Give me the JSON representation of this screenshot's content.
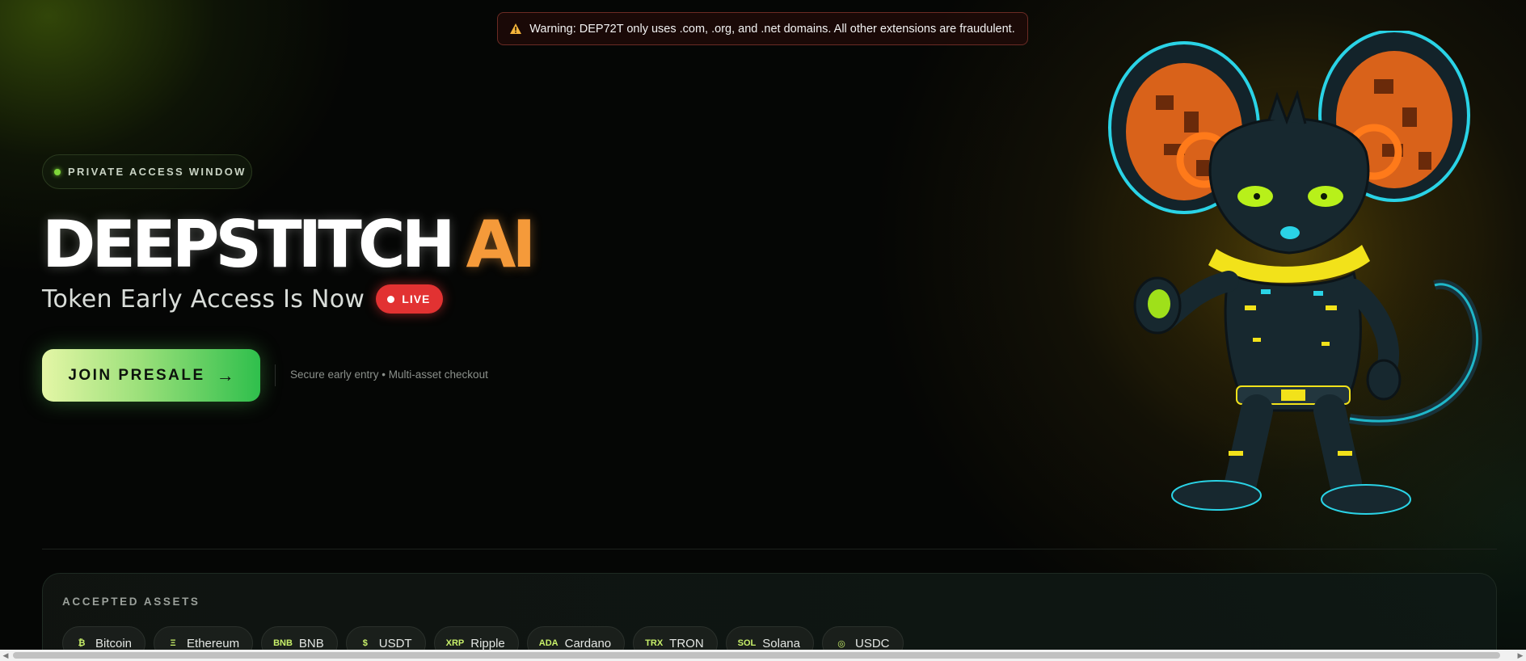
{
  "warning": {
    "icon": "warning-triangle-icon",
    "text": "Warning: DEP72T only uses .com, .org, and .net domains. All other extensions are fraudulent."
  },
  "hero": {
    "badge": "PRIVATE ACCESS WINDOW",
    "title_main": "DEEPSTITCH",
    "title_accent": "AI",
    "subtitle": "Token Early Access Is Now",
    "live_label": "LIVE",
    "cta_label": "JOIN PRESALE",
    "cta_arrow": "→",
    "cta_note": "Secure early entry • Multi-asset checkout"
  },
  "assets": {
    "title": "ACCEPTED ASSETS",
    "items": [
      {
        "symbol": "₿",
        "name": "Bitcoin"
      },
      {
        "symbol": "Ξ",
        "name": "Ethereum"
      },
      {
        "symbol": "BNB",
        "name": "BNB"
      },
      {
        "symbol": "$",
        "name": "USDT"
      },
      {
        "symbol": "XRP",
        "name": "Ripple"
      },
      {
        "symbol": "ADA",
        "name": "Cardano"
      },
      {
        "symbol": "TRX",
        "name": "TRON"
      },
      {
        "symbol": "SOL",
        "name": "Solana"
      },
      {
        "symbol": "◎",
        "name": "USDC"
      }
    ]
  },
  "colors": {
    "accent_orange": "#f59a3a",
    "live_red": "#e23232",
    "cta_green": "#2fbf4c",
    "badge_dot": "#7fd63a"
  }
}
